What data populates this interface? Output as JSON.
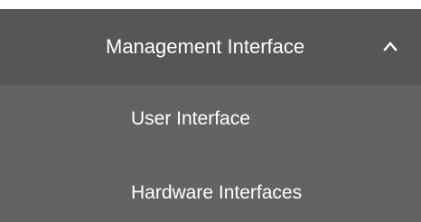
{
  "menu": {
    "header_label": "Management Interface",
    "header_icon": "chevron-up-icon",
    "items": [
      {
        "label": "User Interface"
      },
      {
        "label": "Hardware Interfaces"
      }
    ]
  },
  "colors": {
    "header_bg": "#565656",
    "panel_bg": "#636363",
    "text": "#ffffff"
  }
}
